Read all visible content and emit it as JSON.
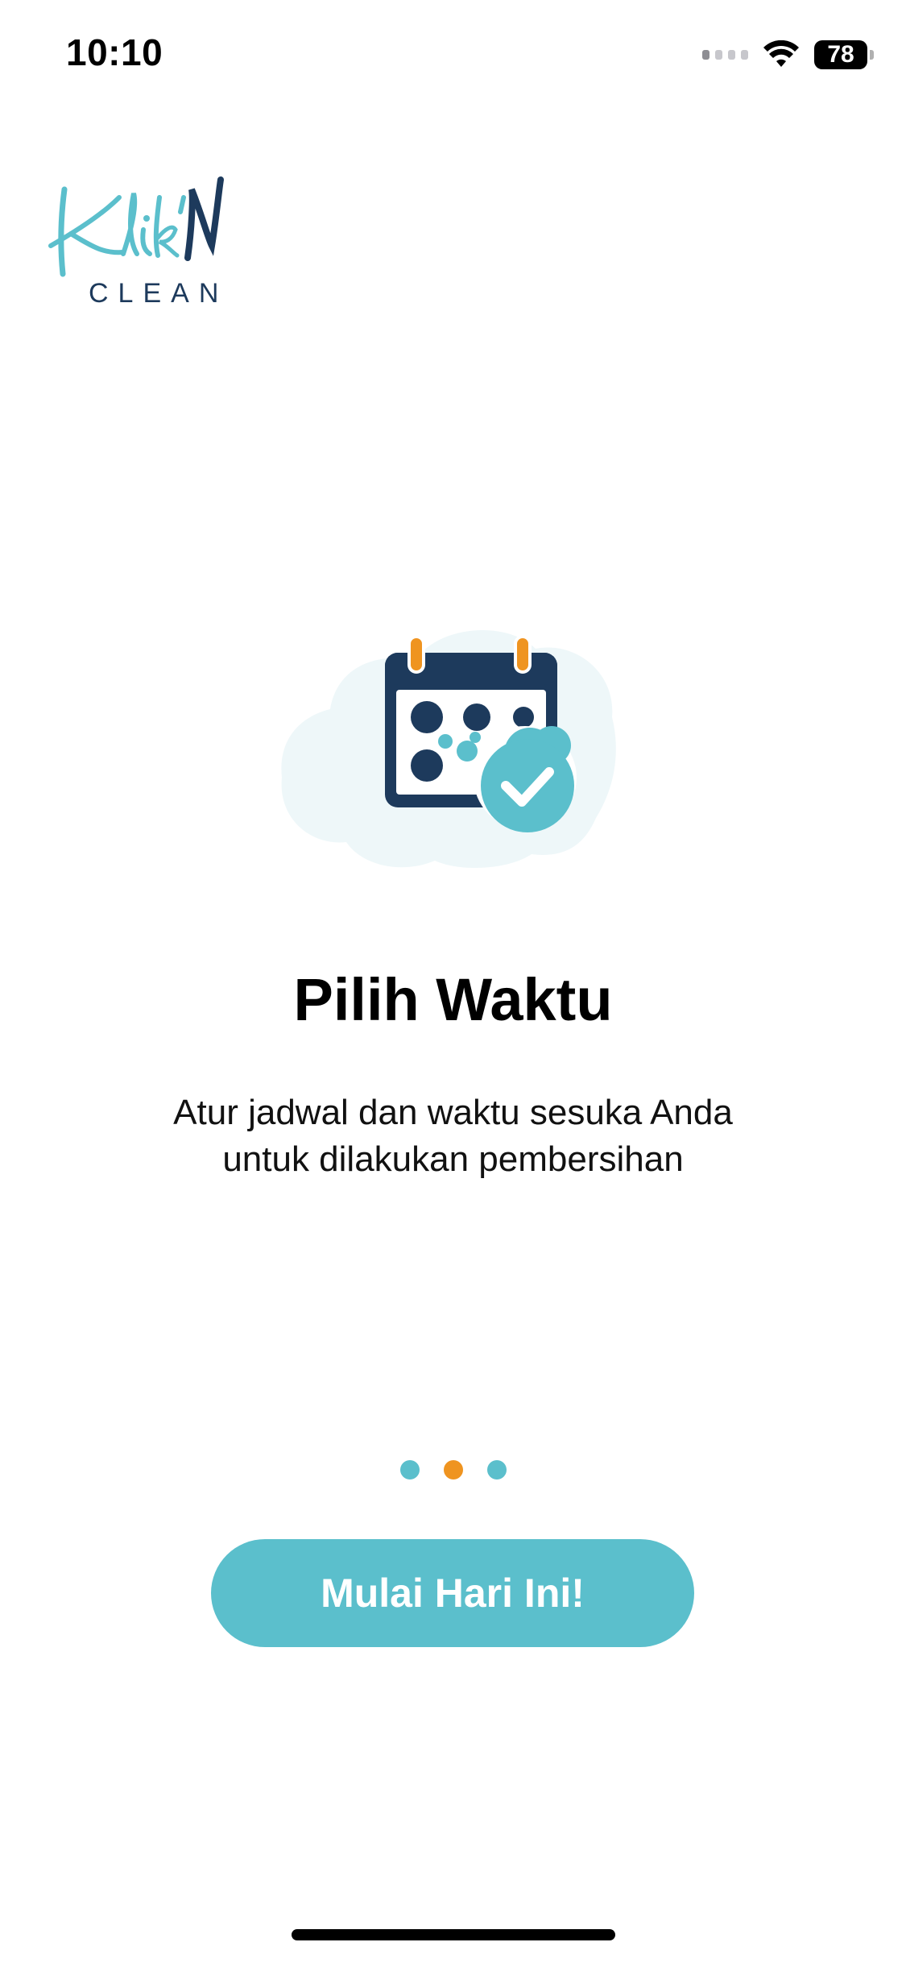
{
  "status_bar": {
    "time": "10:10",
    "battery_level": "78",
    "icons": [
      "cellular-signal-icon",
      "wifi-icon",
      "battery-icon"
    ]
  },
  "logo": {
    "script_text": "Klik'N",
    "word_text": "CLEAN",
    "colors": {
      "script": "#5bbfcc",
      "accent": "#1d3a5c"
    }
  },
  "illustration": {
    "icon": "calendar-check-icon",
    "colors": {
      "calendar": "#1d3a5c",
      "rings": "#ef9420",
      "check_badge": "#5bbfcc",
      "cloud": "#eef7f9"
    }
  },
  "onboarding": {
    "title": "Pilih Waktu",
    "description_line1": "Atur jadwal dan waktu sesuka Anda",
    "description_line2": "untuk dilakukan pembersihan",
    "page_count": 3,
    "active_page": 2
  },
  "cta": {
    "label": "Mulai Hari Ini!",
    "color": "#5bbfcc"
  },
  "colors": {
    "primary": "#5bbfcc",
    "active_dot": "#ef9420"
  }
}
